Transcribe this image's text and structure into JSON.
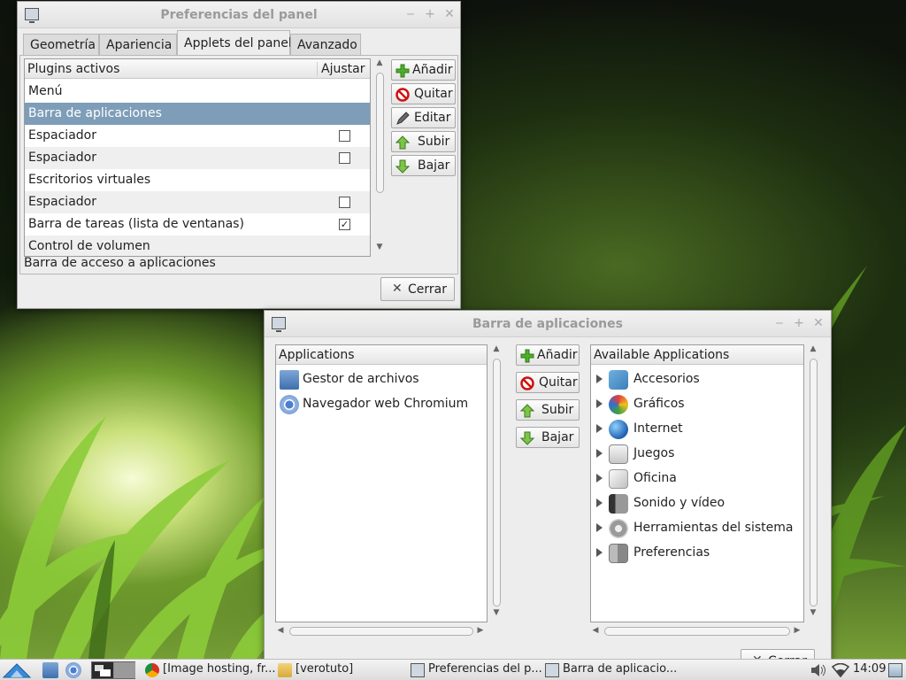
{
  "prefs_window": {
    "title": "Preferencias del panel",
    "tabs": [
      "Geometría",
      "Apariencia",
      "Applets del panel",
      "Avanzado"
    ],
    "active_tab": "Applets del panel",
    "columns": {
      "name": "Plugins activos",
      "adjust": "Ajustar"
    },
    "plugins": [
      {
        "name": "Menú",
        "checkbox": false,
        "checked": false
      },
      {
        "name": "Barra de aplicaciones",
        "checkbox": false,
        "checked": false,
        "selected": true
      },
      {
        "name": "Espaciador",
        "checkbox": true,
        "checked": false
      },
      {
        "name": "Espaciador",
        "checkbox": true,
        "checked": false
      },
      {
        "name": "Escritorios virtuales",
        "checkbox": false,
        "checked": false
      },
      {
        "name": "Espaciador",
        "checkbox": true,
        "checked": false
      },
      {
        "name": "Barra de tareas (lista de ventanas)",
        "checkbox": true,
        "checked": true
      },
      {
        "name": "Control de volumen",
        "checkbox": false,
        "checked": false
      }
    ],
    "buttons": {
      "add": "Añadir",
      "remove": "Quitar",
      "edit": "Editar",
      "up": "Subir",
      "down": "Bajar"
    },
    "status": "Barra de acceso a aplicaciones",
    "close": "Cerrar"
  },
  "launch_window": {
    "title": "Barra de aplicaciones",
    "left_header": "Applications",
    "applications": [
      {
        "name": "Gestor de archivos",
        "icon": "file-manager-icon"
      },
      {
        "name": "Navegador web Chromium",
        "icon": "chromium-icon"
      }
    ],
    "buttons": {
      "add": "Añadir",
      "remove": "Quitar",
      "up": "Subir",
      "down": "Bajar"
    },
    "right_header": "Available Applications",
    "categories": [
      {
        "name": "Accesorios",
        "icon": "accessories-icon"
      },
      {
        "name": "Gráficos",
        "icon": "graphics-icon"
      },
      {
        "name": "Internet",
        "icon": "internet-icon"
      },
      {
        "name": "Juegos",
        "icon": "games-icon"
      },
      {
        "name": "Oficina",
        "icon": "office-icon"
      },
      {
        "name": "Sonido y vídeo",
        "icon": "multimedia-icon"
      },
      {
        "name": "Herramientas del sistema",
        "icon": "system-tools-icon"
      },
      {
        "name": "Preferencias",
        "icon": "preferences-icon"
      }
    ],
    "close_partial": "Cerrar"
  },
  "taskbar": {
    "tasks": [
      {
        "label": "[Image hosting, fr...",
        "icon": "chromium-icon"
      },
      {
        "label": "[verotuto]",
        "icon": "folder-icon"
      },
      {
        "label": "Preferencias del p...",
        "icon": "window-icon"
      },
      {
        "label": "Barra de aplicacio...",
        "icon": "window-icon"
      }
    ],
    "clock": "14:09"
  },
  "colors": {
    "selection": "#7e9db8",
    "window_bg": "#ededed",
    "title_text": "#9a9a9a"
  }
}
